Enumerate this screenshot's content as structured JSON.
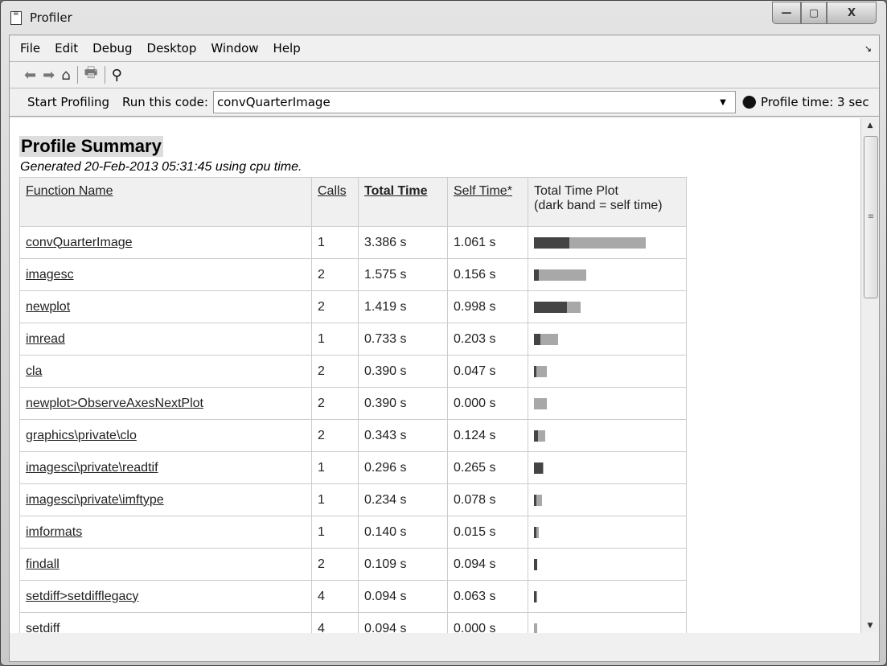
{
  "window": {
    "title": "Profiler",
    "minimize": "—",
    "maximize": "▢",
    "close": "X"
  },
  "menu": [
    "File",
    "Edit",
    "Debug",
    "Desktop",
    "Window",
    "Help"
  ],
  "toolbar": {
    "start_profiling": "Start Profiling",
    "run_label": "Run this code:",
    "run_value": "convQuarterImage",
    "profile_time": "Profile time: 3 sec"
  },
  "summary": {
    "title": "Profile Summary",
    "generated": "Generated 20-Feb-2013 05:31:45 using cpu time.",
    "headers": {
      "name": "Function Name",
      "calls": "Calls",
      "total": "Total Time",
      "self": "Self Time*",
      "plot": "Total Time Plot",
      "plot_note": "(dark band = self time)"
    },
    "rows": [
      {
        "name": "convQuarterImage",
        "calls": "1",
        "total": "3.386 s",
        "self": "1.061 s",
        "t": 3.386,
        "s": 1.061
      },
      {
        "name": "imagesc",
        "calls": "2",
        "total": "1.575 s",
        "self": "0.156 s",
        "t": 1.575,
        "s": 0.156
      },
      {
        "name": "newplot",
        "calls": "2",
        "total": "1.419 s",
        "self": "0.998 s",
        "t": 1.419,
        "s": 0.998
      },
      {
        "name": "imread",
        "calls": "1",
        "total": "0.733 s",
        "self": "0.203 s",
        "t": 0.733,
        "s": 0.203
      },
      {
        "name": "cla",
        "calls": "2",
        "total": "0.390 s",
        "self": "0.047 s",
        "t": 0.39,
        "s": 0.047
      },
      {
        "name": "newplot>ObserveAxesNextPlot",
        "calls": "2",
        "total": "0.390 s",
        "self": "0.000 s",
        "t": 0.39,
        "s": 0.0
      },
      {
        "name": "graphics\\private\\clo",
        "calls": "2",
        "total": "0.343 s",
        "self": "0.124 s",
        "t": 0.343,
        "s": 0.124
      },
      {
        "name": "imagesci\\private\\readtif",
        "calls": "1",
        "total": "0.296 s",
        "self": "0.265 s",
        "t": 0.296,
        "s": 0.265
      },
      {
        "name": "imagesci\\private\\imftype",
        "calls": "1",
        "total": "0.234 s",
        "self": "0.078 s",
        "t": 0.234,
        "s": 0.078
      },
      {
        "name": "imformats",
        "calls": "1",
        "total": "0.140 s",
        "self": "0.015 s",
        "t": 0.14,
        "s": 0.015
      },
      {
        "name": "findall",
        "calls": "2",
        "total": "0.109 s",
        "self": "0.094 s",
        "t": 0.109,
        "s": 0.094
      },
      {
        "name": "setdiff>setdifflegacy",
        "calls": "4",
        "total": "0.094 s",
        "self": "0.063 s",
        "t": 0.094,
        "s": 0.063
      },
      {
        "name": "setdiff",
        "calls": "4",
        "total": "0.094 s",
        "self": "0.000 s",
        "t": 0.094,
        "s": 0.0
      }
    ]
  },
  "colors": {
    "dark": "#444444",
    "light": "#a8a8a8"
  }
}
